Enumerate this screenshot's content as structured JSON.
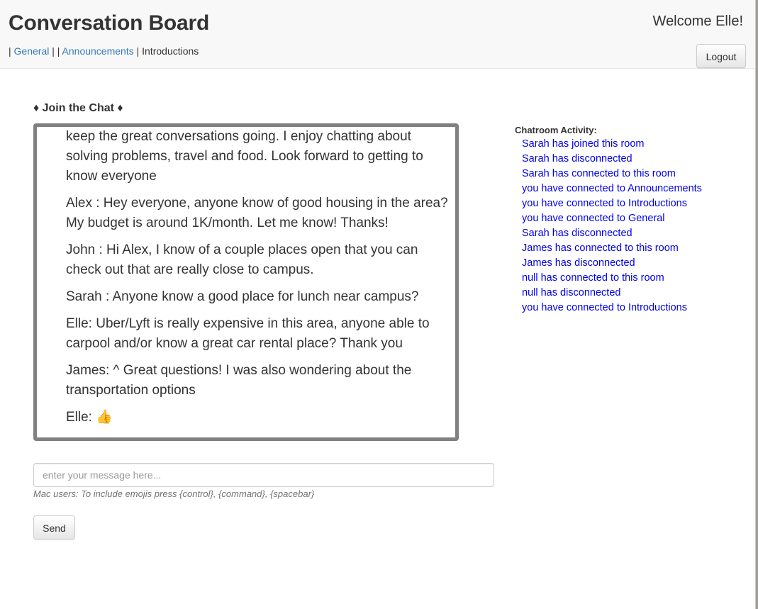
{
  "header": {
    "title": "Conversation Board",
    "welcome": "Welcome Elle!",
    "logout_label": "Logout",
    "nav": {
      "sep1": "|",
      "general": "General",
      "sep2": "| |",
      "announcements": "Announcements",
      "sep3": "|",
      "current": "Introductions"
    }
  },
  "chat": {
    "heading": "♦ Join the Chat ♦",
    "messages": [
      {
        "text": "keep the great conversations going. I enjoy chatting about solving problems, travel and food. Look forward to getting to know everyone"
      },
      {
        "text": "Alex : Hey everyone, anyone know of good housing in the area? My budget is around 1K/month. Let me know! Thanks!"
      },
      {
        "text": "John : Hi Alex, I know of a couple places open that you can check out that are really close to campus."
      },
      {
        "text": "Sarah : Anyone know a good place for lunch near campus?"
      },
      {
        "text": "Elle: Uber/Lyft is really expensive in this area, anyone able to carpool and/or know a great car rental place? Thank you"
      },
      {
        "text": "James: ^ Great questions! I was also wondering about the transportation options"
      },
      {
        "text": "Elle: ",
        "emoji": "👍"
      }
    ]
  },
  "activity": {
    "title": "Chatroom Activity:",
    "items": [
      "Sarah has joined this room",
      "Sarah has disconnected",
      "Sarah has connected to this room",
      "you have connected to Announcements",
      "you have connected to Introductions",
      "you have connected to General",
      "Sarah has disconnected",
      "James has connected to this room",
      "James has disconnected",
      "null has connected to this room",
      "null has disconnected",
      "you have connected to Introductions"
    ]
  },
  "compose": {
    "placeholder": "enter your message here...",
    "hint": "Mac users: To include emojis press {control}, {command}, {spacebar}",
    "send_label": "Send"
  },
  "colors": {
    "link": "#337ab7",
    "activity_text": "#0000ee",
    "chat_border": "#808080"
  }
}
